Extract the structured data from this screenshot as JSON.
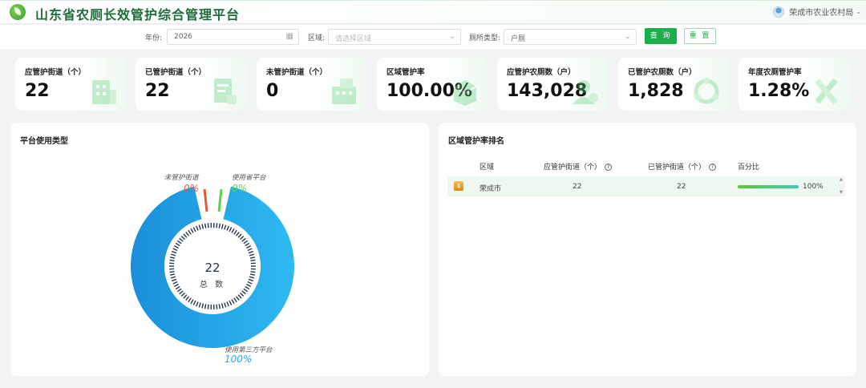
{
  "header": {
    "title": "山东省农厕长效管护综合管理平台",
    "user": "荣成市农业农村局"
  },
  "filters": {
    "year_label": "年份:",
    "year_value": "2026",
    "region_label": "区域:",
    "region_placeholder": "请选择区域",
    "toilet_type_label": "厕所类型:",
    "toilet_type_value": "户厕",
    "query_button": "查 询",
    "reset_button": "重 置"
  },
  "stats": [
    {
      "label": "应管护街道（个）",
      "value": "22",
      "icon": "building-icon"
    },
    {
      "label": "已管护街道（个）",
      "value": "22",
      "icon": "document-icon"
    },
    {
      "label": "未管护街道（个）",
      "value": "0",
      "icon": "building-icon"
    },
    {
      "label": "区域管护率",
      "value": "100.00%",
      "icon": "box-icon"
    },
    {
      "label": "应管护农厕数（户）",
      "value": "143,028",
      "icon": "user-icon"
    },
    {
      "label": "已管护农厕数（户）",
      "value": "1,828",
      "icon": "recycle-icon"
    },
    {
      "label": "年度农厕管护率",
      "value": "1.28%",
      "icon": "tools-icon"
    }
  ],
  "platform_panel": {
    "title": "平台使用类型",
    "center_value": "22",
    "center_label": "总 数"
  },
  "chart_data": {
    "type": "pie",
    "title": "平台使用类型",
    "categories": [
      "未管护街道",
      "使用省平台",
      "使用第三方平台"
    ],
    "values": [
      0,
      0,
      100
    ],
    "labels": [
      "0%",
      "0%",
      "100%"
    ],
    "unit": "%",
    "total": 22,
    "colors": [
      "#e25a3c",
      "#5ecf4e",
      "#2aaae8"
    ]
  },
  "ranking_panel": {
    "title": "区域管护率排名",
    "columns": [
      "区域",
      "应管护街道（个）",
      "已管护街道（个）",
      "百分比"
    ],
    "rows": [
      {
        "rank": "1",
        "region": "荣成市",
        "should": "22",
        "done": "22",
        "percent": "100%",
        "percent_value": 100
      }
    ]
  }
}
